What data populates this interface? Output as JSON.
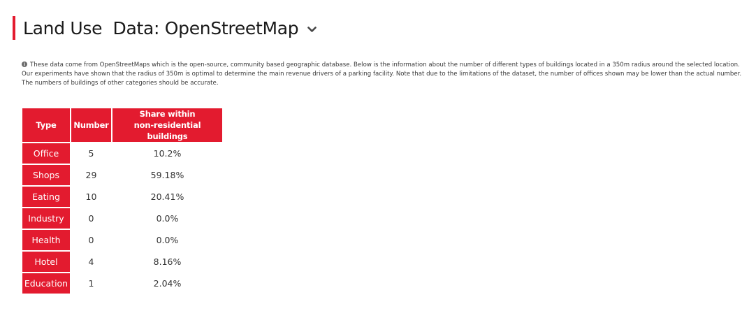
{
  "header": {
    "title": "Land Use  Data: OpenStreetMap",
    "accent_color": "#e31b2f",
    "toggle_icon": "chevron-down-icon"
  },
  "info": {
    "icon": "info-icon",
    "text": "These data come from OpenStreetMaps which is the open-source, community based geographic database.  Below is the information about the number of different types of buildings located in a 350m radius around the selected location. Our experiments have shown that the radius of 350m is optimal to determine the main revenue drivers of a parking facility.  Note that due to the limitations of the dataset, the number of offices shown may be lower than the actual number. The numbers of buildings of other categories should be accurate."
  },
  "table": {
    "headers": {
      "type": "Type",
      "number": "Number",
      "share_line1": "Share within",
      "share_line2": "non-residential buildings"
    },
    "rows": [
      {
        "type": "Office",
        "number": "5",
        "share": "10.2%"
      },
      {
        "type": "Shops",
        "number": "29",
        "share": "59.18%"
      },
      {
        "type": "Eating",
        "number": "10",
        "share": "20.41%"
      },
      {
        "type": "Industry",
        "number": "0",
        "share": "0.0%"
      },
      {
        "type": "Health",
        "number": "0",
        "share": "0.0%"
      },
      {
        "type": "Hotel",
        "number": "4",
        "share": "8.16%"
      },
      {
        "type": "Education",
        "number": "1",
        "share": "2.04%"
      }
    ]
  }
}
